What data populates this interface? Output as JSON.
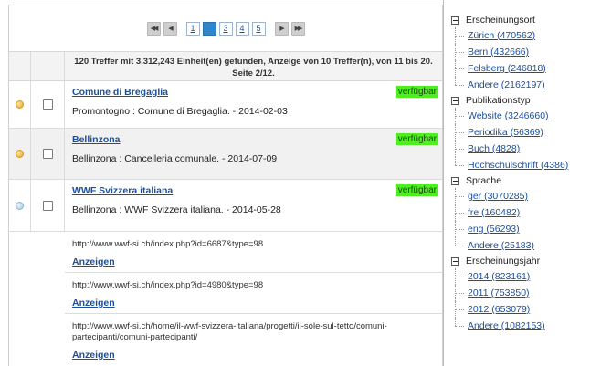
{
  "pagination": {
    "first_label": "◀◀",
    "prev_label": "◀",
    "pages": [
      "1",
      "2",
      "3",
      "4",
      "5"
    ],
    "active_page": "2",
    "next_label": "▶",
    "last_label": "▶▶"
  },
  "summary": "120 Treffer mit 3,312,243 Einheit(en) gefunden, Anzeige von 10 Treffer(n), von 11 bis 20. Seite 2/12.",
  "records": [
    {
      "title": "Comune di Bregaglia",
      "availability": "verfügbar",
      "description": "Promontogno : Comune di Bregaglia. - 2014-02-03",
      "status_dot": "yellow-dot-icon"
    },
    {
      "title": "Bellinzona",
      "availability": "verfügbar",
      "description": "Bellinzona : Cancelleria comunale. - 2014-07-09",
      "status_dot": "yellow-dot-icon"
    },
    {
      "title": "WWF Svizzera italiana",
      "availability": "verfügbar",
      "description": "Bellinzona : WWF Svizzera italiana. - 2014-05-28",
      "status_dot": "blue-dot-icon"
    }
  ],
  "links": [
    {
      "url": "http://www.wwf-si.ch/index.php?id=6687&type=98",
      "action": "Anzeigen"
    },
    {
      "url": "http://www.wwf-si.ch/index.php?id=4980&type=98",
      "action": "Anzeigen"
    },
    {
      "url": "http://www.wwf-si.ch/home/il-wwf-svizzera-italiana/progetti/il-sole-sul-tetto/comuni-partecipanti/comuni-partecipanti/",
      "action": "Anzeigen"
    }
  ],
  "facets": [
    {
      "title": "Erscheinungsort",
      "items": [
        "Zürich (470562)",
        "Bern (432666)",
        "Felsberg (246818)",
        "Andere (2162197)"
      ]
    },
    {
      "title": "Publikationstyp",
      "items": [
        "Website (3246660)",
        "Periodika (56369)",
        "Buch (4828)",
        "Hochschulschrift (4386)"
      ]
    },
    {
      "title": "Sprache",
      "items": [
        "ger (3070285)",
        "fre (160482)",
        "eng (56293)",
        "Andere (25183)"
      ]
    },
    {
      "title": "Erscheinungsjahr",
      "items": [
        "2014 (823161)",
        "2011 (753850)",
        "2012 (653079)",
        "Andere (1082153)"
      ]
    }
  ],
  "colors": {
    "link": "#1a4f9c",
    "available_badge": "#4cf01e",
    "active_page": "#2f86c9"
  }
}
